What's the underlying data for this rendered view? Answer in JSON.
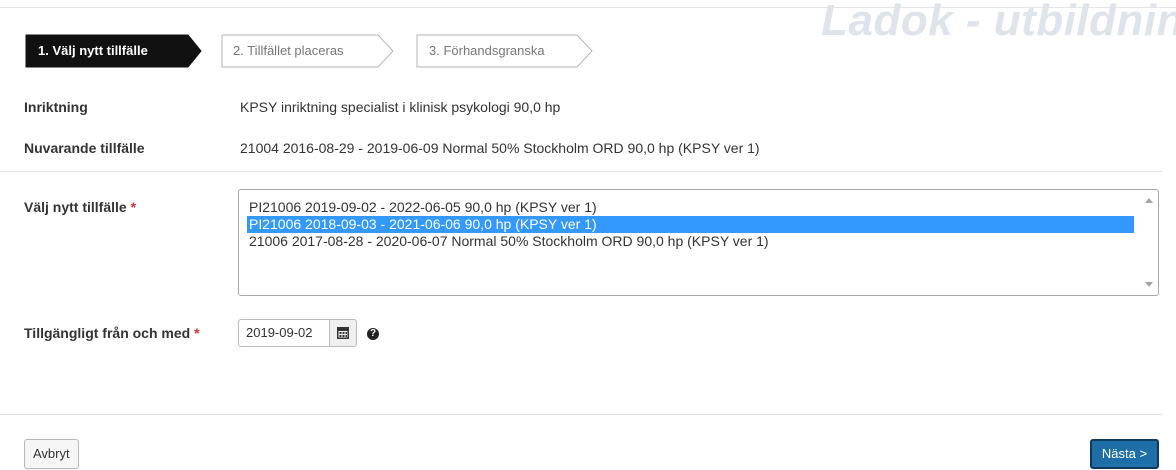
{
  "watermark": "Ladok - utbildnin",
  "steps": [
    {
      "label": "1. Välj nytt tillfälle",
      "active": true
    },
    {
      "label": "2. Tillfället placeras",
      "active": false
    },
    {
      "label": "3. Förhandsgranska",
      "active": false
    }
  ],
  "fields": {
    "inriktning": {
      "label": "Inriktning",
      "value": "KPSY inriktning specialist i klinisk psykologi 90,0 hp"
    },
    "nuvarande": {
      "label": "Nuvarande tillfälle",
      "value": "21004 2016-08-29 - 2019-06-09 Normal 50% Stockholm ORD 90,0 hp (KPSY ver 1)"
    },
    "valj": {
      "label": "Välj nytt tillfälle",
      "required_mark": "*",
      "options": [
        "PI21006 2019-09-02 - 2022-06-05 90,0 hp (KPSY ver 1)",
        "PI21006 2018-09-03 - 2021-06-06 90,0 hp (KPSY ver 1)",
        "21006 2017-08-28 - 2020-06-07 Normal 50% Stockholm ORD 90,0 hp (KPSY ver 1)"
      ],
      "selected_option": "PI21006 2018-09-03 - 2021-06-06 90,0 hp (KPSY ver 1)"
    },
    "tillganglig": {
      "label": "Tillgängligt från och med",
      "required_mark": "*",
      "value": "2019-09-02"
    }
  },
  "icons": {
    "calendar": "calendar-icon",
    "help": "question-circle-icon"
  },
  "buttons": {
    "cancel": "Avbryt",
    "next": "Nästa >"
  },
  "colors": {
    "active_step": "#111111",
    "selection": "#3399ff",
    "primary_button": "#1e6fa8",
    "required": "#d9302c"
  }
}
